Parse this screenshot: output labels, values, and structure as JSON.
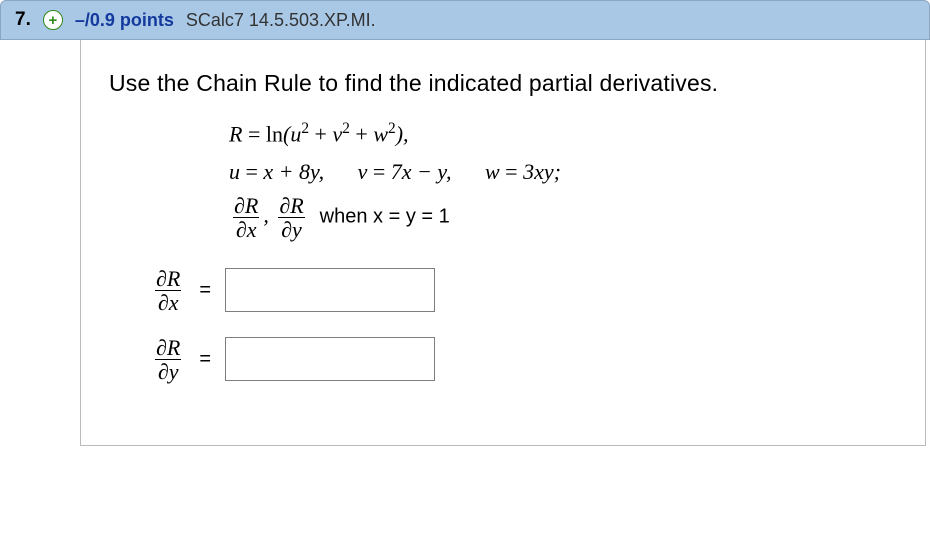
{
  "header": {
    "number": "7.",
    "expand_glyph": "+",
    "points": "–/0.9 points",
    "reference": "SCalc7 14.5.503.XP.MI."
  },
  "prompt": "Use the Chain Rule to find the indicated partial derivatives.",
  "math": {
    "R_lhs": "R",
    "ln": "ln",
    "u": "u",
    "v": "v",
    "w": "w",
    "sq": "2",
    "u_expr_lhs": "u",
    "u_expr_rhs": "x + 8y,",
    "v_expr_lhs": "v",
    "v_expr_rhs": "7x − y,",
    "w_expr_lhs": "w",
    "w_expr_rhs": "3xy;",
    "partial": "∂",
    "Rvar": "R",
    "xvar": "x",
    "yvar": "y",
    "when_text": "when x = y = 1",
    "comma": ","
  },
  "answers": {
    "row1": {
      "value": "",
      "placeholder": ""
    },
    "row2": {
      "value": "",
      "placeholder": ""
    },
    "equals": "="
  }
}
